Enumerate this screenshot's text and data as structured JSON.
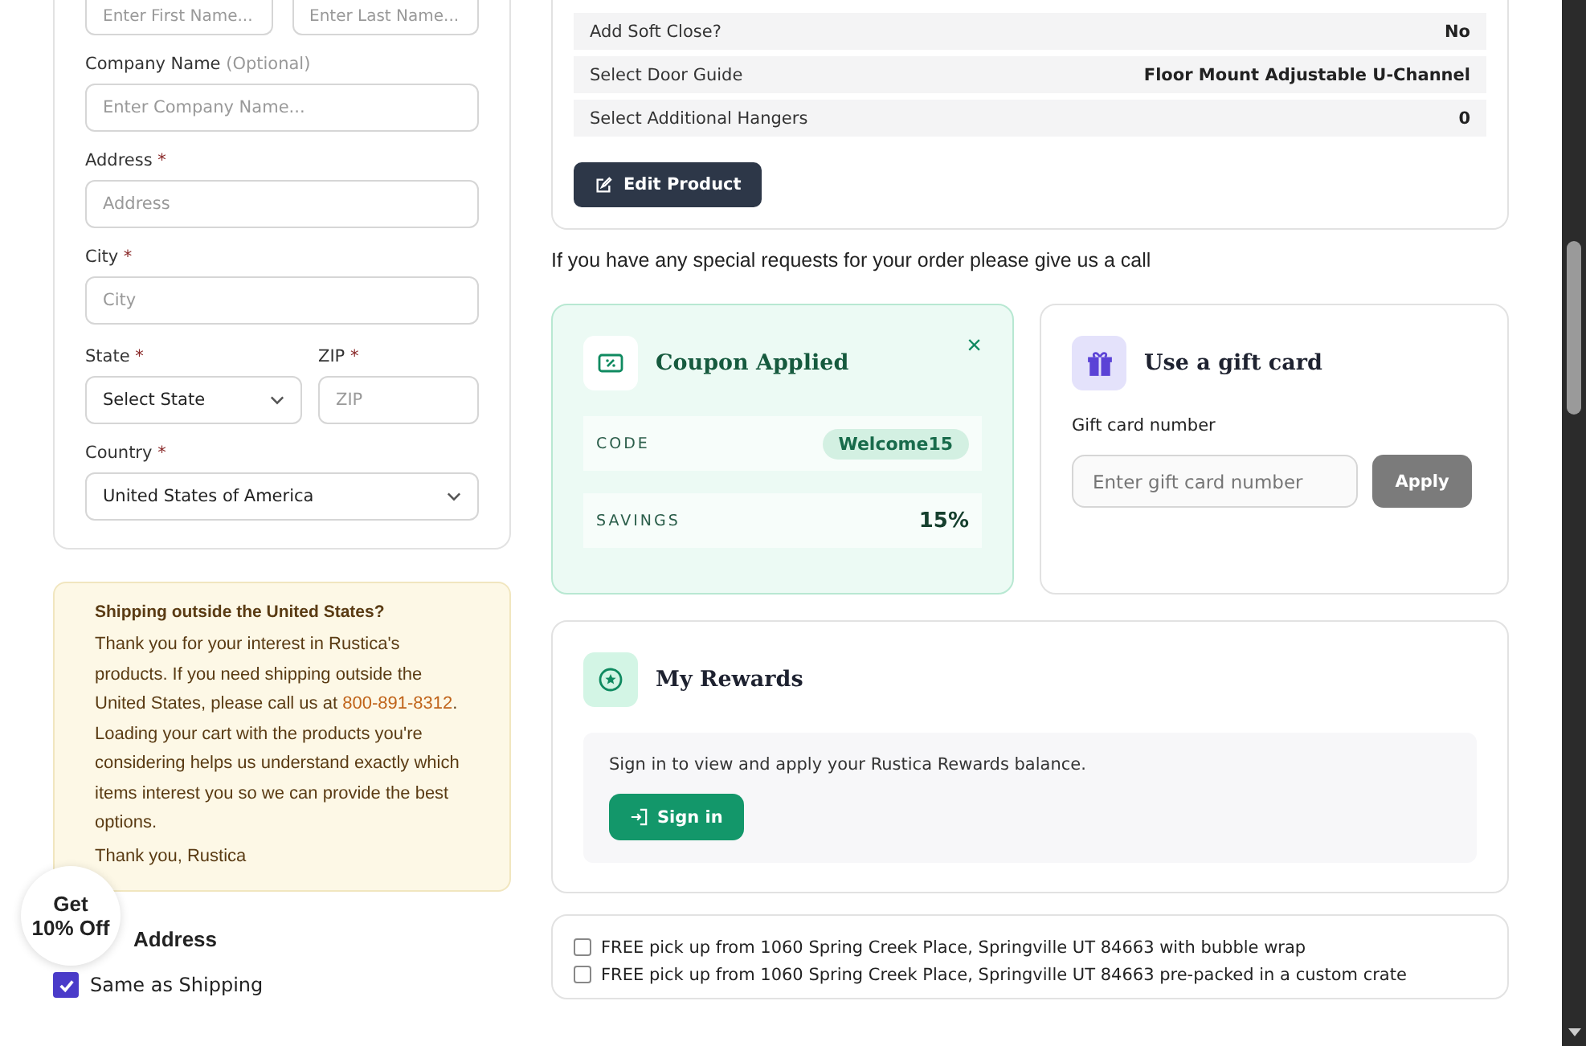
{
  "name_fields": [
    {
      "placeholder": "Enter First Name..."
    },
    {
      "placeholder": "Enter Last Name..."
    }
  ],
  "address_form": {
    "company": {
      "label": "Company Name",
      "optional": "(Optional)",
      "placeholder": "Enter Company Name..."
    },
    "address": {
      "label": "Address",
      "required": "*",
      "placeholder": "Address"
    },
    "city": {
      "label": "City",
      "required": "*",
      "placeholder": "City"
    },
    "state": {
      "label": "State",
      "required": "*",
      "value": "Select State"
    },
    "zip": {
      "label": "ZIP",
      "required": "*",
      "placeholder": "ZIP"
    },
    "country": {
      "label": "Country",
      "required": "*",
      "value": "United States of America"
    }
  },
  "shipping_notice": {
    "title": "Shipping outside the United States?",
    "body_before": "Thank you for your interest in Rustica's products. If you need shipping outside the United States, please call us at ",
    "phone": "800-891-8312",
    "body_after": ". Loading your cart with the products you're considering helps us understand exactly which items interest you so we can provide the best options.",
    "signoff": "Thank you, Rustica"
  },
  "promo_badge": {
    "line_1": "Get",
    "line_2": "10% Off"
  },
  "billing": {
    "heading": "Address",
    "same_as_shipping": {
      "label": "Same as Shipping",
      "checked": true
    }
  },
  "product_options": [
    {
      "label": "Add Soft Close?",
      "value": "No"
    },
    {
      "label": "Select Door Guide",
      "value": "Floor Mount Adjustable U-Channel"
    },
    {
      "label": "Select Additional Hangers",
      "value": "0"
    }
  ],
  "edit_button": "Edit Product",
  "special_requests": "If you have any special requests for your order please give us a call",
  "coupon": {
    "title": "Coupon Applied",
    "close": "×",
    "code_label": "CODE",
    "code": "Welcome15",
    "savings_label": "SAVINGS",
    "savings": "15%"
  },
  "gift_card": {
    "title": "Use a gift card",
    "field_label": "Gift card number",
    "placeholder": "Enter gift card number",
    "button": "Apply"
  },
  "rewards": {
    "title": "My Rewards",
    "message": "Sign in to view and apply your Rustica Rewards balance.",
    "button": "Sign in"
  },
  "pickup_options": [
    {
      "label": "FREE pick up from 1060 Spring Creek Place, Springville UT 84663 with bubble wrap",
      "checked": false
    },
    {
      "label": "FREE pick up from 1060 Spring Creek Place, Springville UT 84663 pre-packed in a custom crate",
      "checked": false
    }
  ]
}
